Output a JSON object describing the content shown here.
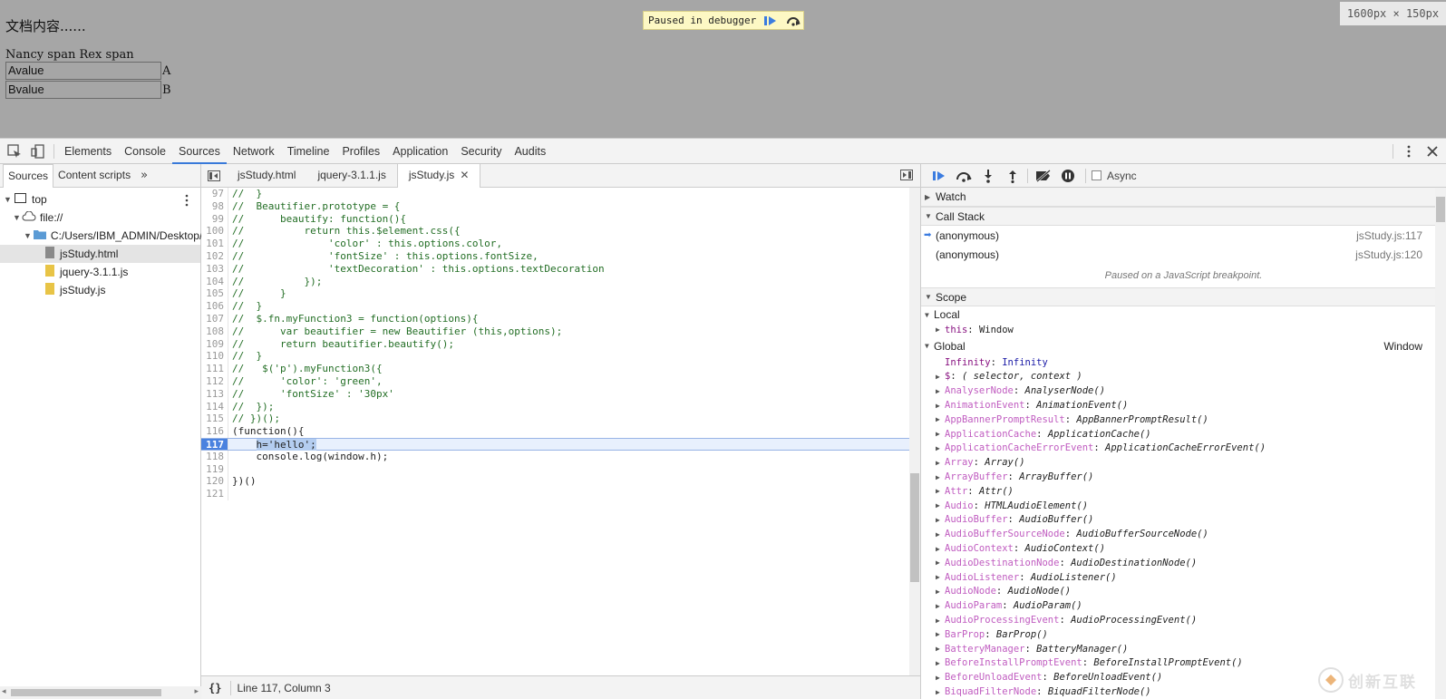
{
  "page": {
    "title_text": "文档内容......",
    "names_line": "Nancy span Rex span",
    "rows": [
      {
        "value": "Avalue",
        "label": "A"
      },
      {
        "value": "Bvalue",
        "label": "B"
      }
    ],
    "paused_banner": "Paused in debugger",
    "dimension_readout": "1600px × 150px"
  },
  "devtools": {
    "main_tabs": [
      "Elements",
      "Console",
      "Sources",
      "Network",
      "Timeline",
      "Profiles",
      "Application",
      "Security",
      "Audits"
    ],
    "active_main_tab": "Sources",
    "navigator": {
      "tabs": [
        "Sources",
        "Content scripts"
      ],
      "tree": {
        "top": "top",
        "origin": "file://",
        "folder": "C:/Users/IBM_ADMIN/Desktop/",
        "files": [
          "jsStudy.html",
          "jquery-3.1.1.js",
          "jsStudy.js"
        ]
      }
    },
    "editor": {
      "tabs": [
        "jsStudy.html",
        "jquery-3.1.1.js",
        "jsStudy.js"
      ],
      "active_tab": "jsStudy.js",
      "lines": [
        {
          "n": "97",
          "text": "//  }"
        },
        {
          "n": "98",
          "text": "//  Beautifier.prototype = {"
        },
        {
          "n": "99",
          "text": "//      beautify: function(){"
        },
        {
          "n": "100",
          "text": "//          return this.$element.css({"
        },
        {
          "n": "101",
          "text": "//              'color' : this.options.color,"
        },
        {
          "n": "102",
          "text": "//              'fontSize' : this.options.fontSize,"
        },
        {
          "n": "103",
          "text": "//              'textDecoration' : this.options.textDecoration"
        },
        {
          "n": "104",
          "text": "//          });"
        },
        {
          "n": "105",
          "text": "//      }"
        },
        {
          "n": "106",
          "text": "//  }"
        },
        {
          "n": "107",
          "text": "//  $.fn.myFunction3 = function(options){"
        },
        {
          "n": "108",
          "text": "//      var beautifier = new Beautifier (this,options);"
        },
        {
          "n": "109",
          "text": "//      return beautifier.beautify();"
        },
        {
          "n": "110",
          "text": "//  }"
        },
        {
          "n": "111",
          "text": "//   $('p').myFunction3({"
        },
        {
          "n": "112",
          "text": "//      'color': 'green',"
        },
        {
          "n": "113",
          "text": "//      'fontSize' : '30px'"
        },
        {
          "n": "114",
          "text": "//  });"
        },
        {
          "n": "115",
          "text": "// })();"
        },
        {
          "n": "116",
          "text": "(function(){"
        },
        {
          "n": "117",
          "text": "    h='hello';"
        },
        {
          "n": "118",
          "text": "    console.log(window.h);"
        },
        {
          "n": "119",
          "text": ""
        },
        {
          "n": "120",
          "text": "})()"
        },
        {
          "n": "121",
          "text": ""
        }
      ],
      "status": "Line 117, Column 3"
    },
    "debugger": {
      "async_label": "Async",
      "watch_label": "Watch",
      "call_stack_label": "Call Stack",
      "call_stack": [
        {
          "fn": "(anonymous)",
          "loc": "jsStudy.js:117"
        },
        {
          "fn": "(anonymous)",
          "loc": "jsStudy.js:120"
        }
      ],
      "paused_message": "Paused on a JavaScript breakpoint.",
      "scope_label": "Scope",
      "local_label": "Local",
      "local_this": {
        "name": "this",
        "value": "Window"
      },
      "global_label": "Global",
      "global_value": "Window",
      "globals": [
        {
          "name": "Infinity",
          "value": "Infinity"
        },
        {
          "name": "$",
          "value": "( selector, context )"
        },
        {
          "name": "AnalyserNode",
          "value": "AnalyserNode()"
        },
        {
          "name": "AnimationEvent",
          "value": "AnimationEvent()"
        },
        {
          "name": "AppBannerPromptResult",
          "value": "AppBannerPromptResult()"
        },
        {
          "name": "ApplicationCache",
          "value": "ApplicationCache()"
        },
        {
          "name": "ApplicationCacheErrorEvent",
          "value": "ApplicationCacheErrorEvent()"
        },
        {
          "name": "Array",
          "value": "Array()"
        },
        {
          "name": "ArrayBuffer",
          "value": "ArrayBuffer()"
        },
        {
          "name": "Attr",
          "value": "Attr()"
        },
        {
          "name": "Audio",
          "value": "HTMLAudioElement()"
        },
        {
          "name": "AudioBuffer",
          "value": "AudioBuffer()"
        },
        {
          "name": "AudioBufferSourceNode",
          "value": "AudioBufferSourceNode()"
        },
        {
          "name": "AudioContext",
          "value": "AudioContext()"
        },
        {
          "name": "AudioDestinationNode",
          "value": "AudioDestinationNode()"
        },
        {
          "name": "AudioListener",
          "value": "AudioListener()"
        },
        {
          "name": "AudioNode",
          "value": "AudioNode()"
        },
        {
          "name": "AudioParam",
          "value": "AudioParam()"
        },
        {
          "name": "AudioProcessingEvent",
          "value": "AudioProcessingEvent()"
        },
        {
          "name": "BarProp",
          "value": "BarProp()"
        },
        {
          "name": "BatteryManager",
          "value": "BatteryManager()"
        },
        {
          "name": "BeforeInstallPromptEvent",
          "value": "BeforeInstallPromptEvent()"
        },
        {
          "name": "BeforeUnloadEvent",
          "value": "BeforeUnloadEvent()"
        },
        {
          "name": "BiquadFilterNode",
          "value": "BiquadFilterNode()"
        }
      ]
    }
  },
  "watermark": "创新互联",
  "colors": {
    "accent": "#3879d9",
    "exec_line": "#4a82df",
    "prop_name": "#c05cc0",
    "comment_green": "#236e25"
  }
}
